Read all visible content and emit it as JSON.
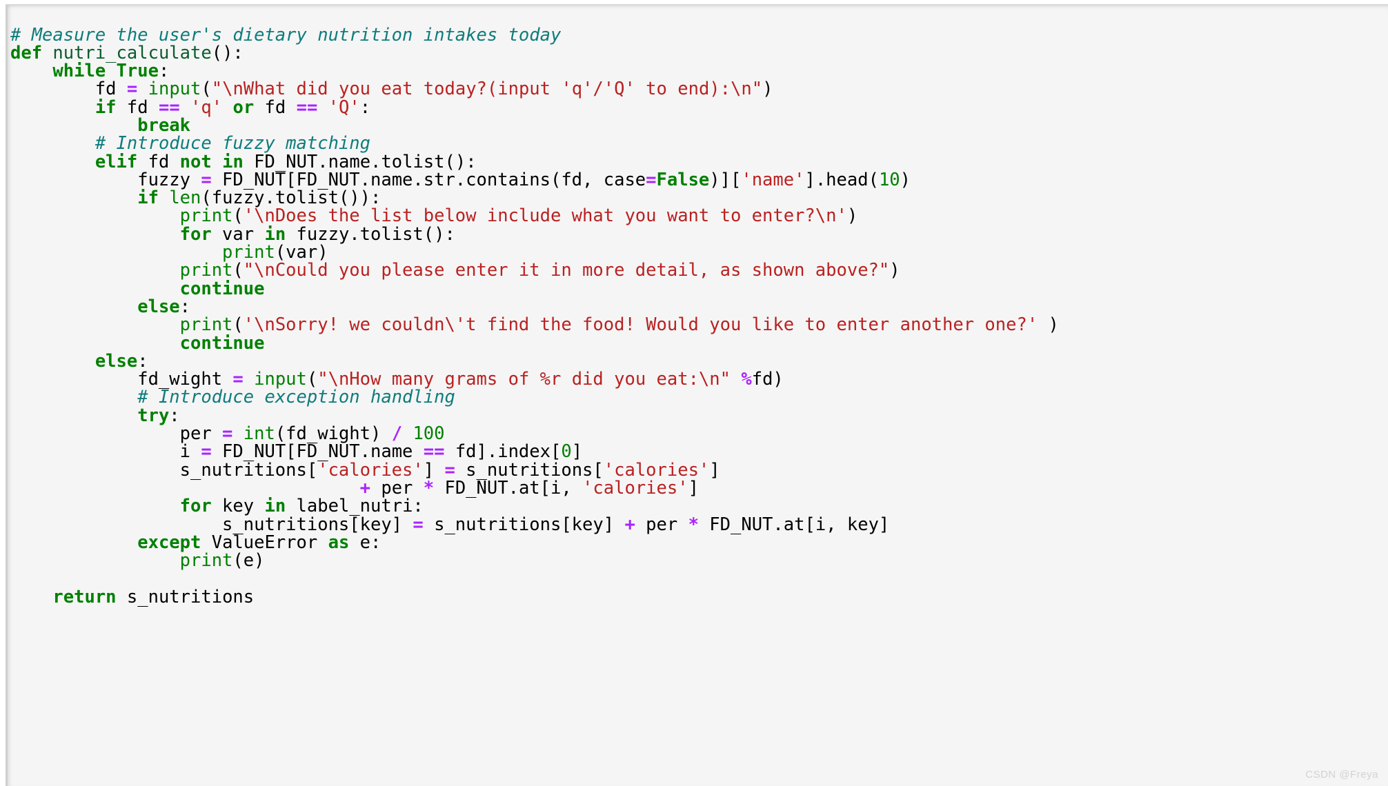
{
  "meta": {
    "language": "python",
    "background_color": "#f5f5f5",
    "page_background": "#ffffff",
    "watermark": "CSDN @Freya"
  },
  "palette": {
    "keyword": "#008000",
    "builtin": "#008000",
    "string": "#ba2121",
    "number": "#008000",
    "operator": "#aa22ff",
    "comment": "#0e7c7b",
    "plain": "#000000",
    "constant": "#008000"
  },
  "code": {
    "lines": [
      {
        "index": 1,
        "text": "# Measure the user's dietary nutrition intakes today",
        "tokens": [
          {
            "t": "com",
            "s": "# Measure the user's dietary nutrition intakes today"
          }
        ]
      },
      {
        "index": 2,
        "text": "def nutri_calculate():",
        "tokens": [
          {
            "t": "kw",
            "s": "def"
          },
          {
            "t": "plain",
            "s": " "
          },
          {
            "t": "defname",
            "s": "nutri_calculate"
          },
          {
            "t": "punct",
            "s": "():"
          }
        ]
      },
      {
        "index": 3,
        "text": "    while True:",
        "tokens": [
          {
            "t": "plain",
            "s": "    "
          },
          {
            "t": "kw",
            "s": "while"
          },
          {
            "t": "plain",
            "s": " "
          },
          {
            "t": "const",
            "s": "True"
          },
          {
            "t": "punct",
            "s": ":"
          }
        ]
      },
      {
        "index": 4,
        "text": "        fd = input(\"\\nWhat did you eat today?(input 'q'/'Q' to end):\\n\")",
        "tokens": [
          {
            "t": "plain",
            "s": "        fd "
          },
          {
            "t": "op",
            "s": "="
          },
          {
            "t": "plain",
            "s": " "
          },
          {
            "t": "builtin",
            "s": "input"
          },
          {
            "t": "punct",
            "s": "("
          },
          {
            "t": "str",
            "s": "\"\\nWhat did you eat today?(input 'q'/'Q' to end):\\n\""
          },
          {
            "t": "punct",
            "s": ")"
          }
        ]
      },
      {
        "index": 5,
        "text": "        if fd == 'q' or fd == 'Q':",
        "tokens": [
          {
            "t": "plain",
            "s": "        "
          },
          {
            "t": "kw",
            "s": "if"
          },
          {
            "t": "plain",
            "s": " fd "
          },
          {
            "t": "op",
            "s": "=="
          },
          {
            "t": "plain",
            "s": " "
          },
          {
            "t": "str",
            "s": "'q'"
          },
          {
            "t": "plain",
            "s": " "
          },
          {
            "t": "kw",
            "s": "or"
          },
          {
            "t": "plain",
            "s": " fd "
          },
          {
            "t": "op",
            "s": "=="
          },
          {
            "t": "plain",
            "s": " "
          },
          {
            "t": "str",
            "s": "'Q'"
          },
          {
            "t": "punct",
            "s": ":"
          }
        ]
      },
      {
        "index": 6,
        "text": "            break",
        "tokens": [
          {
            "t": "plain",
            "s": "            "
          },
          {
            "t": "kw",
            "s": "break"
          }
        ]
      },
      {
        "index": 7,
        "text": "        # Introduce fuzzy matching",
        "tokens": [
          {
            "t": "plain",
            "s": "        "
          },
          {
            "t": "com",
            "s": "# Introduce fuzzy matching"
          }
        ]
      },
      {
        "index": 8,
        "text": "        elif fd not in FD_NUT.name.tolist():",
        "tokens": [
          {
            "t": "plain",
            "s": "        "
          },
          {
            "t": "kw",
            "s": "elif"
          },
          {
            "t": "plain",
            "s": " fd "
          },
          {
            "t": "kw",
            "s": "not"
          },
          {
            "t": "plain",
            "s": " "
          },
          {
            "t": "kw",
            "s": "in"
          },
          {
            "t": "plain",
            "s": " FD_NUT.name.tolist():"
          }
        ]
      },
      {
        "index": 9,
        "text": "            fuzzy = FD_NUT[FD_NUT.name.str.contains(fd, case=False)]['name'].head(10)",
        "tokens": [
          {
            "t": "plain",
            "s": "            fuzzy "
          },
          {
            "t": "op",
            "s": "="
          },
          {
            "t": "plain",
            "s": " FD_NUT[FD_NUT.name.str.contains(fd, case"
          },
          {
            "t": "op",
            "s": "="
          },
          {
            "t": "const",
            "s": "False"
          },
          {
            "t": "plain",
            "s": ")]["
          },
          {
            "t": "str",
            "s": "'name'"
          },
          {
            "t": "plain",
            "s": "].head("
          },
          {
            "t": "num",
            "s": "10"
          },
          {
            "t": "plain",
            "s": ")"
          }
        ]
      },
      {
        "index": 10,
        "text": "            if len(fuzzy.tolist()):",
        "tokens": [
          {
            "t": "plain",
            "s": "            "
          },
          {
            "t": "kw",
            "s": "if"
          },
          {
            "t": "plain",
            "s": " "
          },
          {
            "t": "builtin",
            "s": "len"
          },
          {
            "t": "plain",
            "s": "(fuzzy.tolist()):"
          }
        ]
      },
      {
        "index": 11,
        "text": "                print('\\nDoes the list below include what you want to enter?\\n')",
        "tokens": [
          {
            "t": "plain",
            "s": "                "
          },
          {
            "t": "builtin",
            "s": "print"
          },
          {
            "t": "punct",
            "s": "("
          },
          {
            "t": "str",
            "s": "'\\nDoes the list below include what you want to enter?\\n'"
          },
          {
            "t": "punct",
            "s": ")"
          }
        ]
      },
      {
        "index": 12,
        "text": "                for var in fuzzy.tolist():",
        "tokens": [
          {
            "t": "plain",
            "s": "                "
          },
          {
            "t": "kw",
            "s": "for"
          },
          {
            "t": "plain",
            "s": " var "
          },
          {
            "t": "kw",
            "s": "in"
          },
          {
            "t": "plain",
            "s": " fuzzy.tolist():"
          }
        ]
      },
      {
        "index": 13,
        "text": "                    print(var)",
        "tokens": [
          {
            "t": "plain",
            "s": "                    "
          },
          {
            "t": "builtin",
            "s": "print"
          },
          {
            "t": "plain",
            "s": "(var)"
          }
        ]
      },
      {
        "index": 14,
        "text": "                print(\"\\nCould you please enter it in more detail, as shown above?\")",
        "tokens": [
          {
            "t": "plain",
            "s": "                "
          },
          {
            "t": "builtin",
            "s": "print"
          },
          {
            "t": "punct",
            "s": "("
          },
          {
            "t": "str",
            "s": "\"\\nCould you please enter it in more detail, as shown above?\""
          },
          {
            "t": "punct",
            "s": ")"
          }
        ]
      },
      {
        "index": 15,
        "text": "                continue",
        "tokens": [
          {
            "t": "plain",
            "s": "                "
          },
          {
            "t": "kw",
            "s": "continue"
          }
        ]
      },
      {
        "index": 16,
        "text": "            else:",
        "tokens": [
          {
            "t": "plain",
            "s": "            "
          },
          {
            "t": "kw",
            "s": "else"
          },
          {
            "t": "punct",
            "s": ":"
          }
        ]
      },
      {
        "index": 17,
        "text": "                print('\\nSorry! we couldn\\'t find the food! Would you like to enter another one?' )",
        "tokens": [
          {
            "t": "plain",
            "s": "                "
          },
          {
            "t": "builtin",
            "s": "print"
          },
          {
            "t": "punct",
            "s": "("
          },
          {
            "t": "str",
            "s": "'\\nSorry! we couldn\\'t find the food! Would you like to enter another one?'"
          },
          {
            "t": "punct",
            "s": " )"
          }
        ]
      },
      {
        "index": 18,
        "text": "                continue",
        "tokens": [
          {
            "t": "plain",
            "s": "                "
          },
          {
            "t": "kw",
            "s": "continue"
          }
        ]
      },
      {
        "index": 19,
        "text": "        else:",
        "tokens": [
          {
            "t": "plain",
            "s": "        "
          },
          {
            "t": "kw",
            "s": "else"
          },
          {
            "t": "punct",
            "s": ":"
          }
        ]
      },
      {
        "index": 20,
        "text": "            fd_wight = input(\"\\nHow many grams of %r did you eat:\\n\" %fd)",
        "tokens": [
          {
            "t": "plain",
            "s": "            fd_wight "
          },
          {
            "t": "op",
            "s": "="
          },
          {
            "t": "plain",
            "s": " "
          },
          {
            "t": "builtin",
            "s": "input"
          },
          {
            "t": "punct",
            "s": "("
          },
          {
            "t": "str",
            "s": "\"\\nHow many grams of %r did you eat:\\n\""
          },
          {
            "t": "plain",
            "s": " "
          },
          {
            "t": "op",
            "s": "%"
          },
          {
            "t": "plain",
            "s": "fd)"
          }
        ]
      },
      {
        "index": 21,
        "text": "            # Introduce exception handling",
        "tokens": [
          {
            "t": "plain",
            "s": "            "
          },
          {
            "t": "com",
            "s": "# Introduce exception handling"
          }
        ]
      },
      {
        "index": 22,
        "text": "            try:",
        "tokens": [
          {
            "t": "plain",
            "s": "            "
          },
          {
            "t": "kw",
            "s": "try"
          },
          {
            "t": "punct",
            "s": ":"
          }
        ]
      },
      {
        "index": 23,
        "text": "                per = int(fd_wight) / 100",
        "tokens": [
          {
            "t": "plain",
            "s": "                per "
          },
          {
            "t": "op",
            "s": "="
          },
          {
            "t": "plain",
            "s": " "
          },
          {
            "t": "builtin",
            "s": "int"
          },
          {
            "t": "plain",
            "s": "(fd_wight) "
          },
          {
            "t": "op",
            "s": "/"
          },
          {
            "t": "plain",
            "s": " "
          },
          {
            "t": "num",
            "s": "100"
          }
        ]
      },
      {
        "index": 24,
        "text": "                i = FD_NUT[FD_NUT.name == fd].index[0]",
        "tokens": [
          {
            "t": "plain",
            "s": "                i "
          },
          {
            "t": "op",
            "s": "="
          },
          {
            "t": "plain",
            "s": " FD_NUT[FD_NUT.name "
          },
          {
            "t": "op",
            "s": "=="
          },
          {
            "t": "plain",
            "s": " fd].index["
          },
          {
            "t": "num",
            "s": "0"
          },
          {
            "t": "plain",
            "s": "]"
          }
        ]
      },
      {
        "index": 25,
        "text": "                s_nutritions['calories'] = s_nutritions['calories']",
        "tokens": [
          {
            "t": "plain",
            "s": "                s_nutritions["
          },
          {
            "t": "str",
            "s": "'calories'"
          },
          {
            "t": "plain",
            "s": "] "
          },
          {
            "t": "op",
            "s": "="
          },
          {
            "t": "plain",
            "s": " s_nutritions["
          },
          {
            "t": "str",
            "s": "'calories'"
          },
          {
            "t": "plain",
            "s": "]"
          }
        ]
      },
      {
        "index": 26,
        "text": "                                 + per * FD_NUT.at[i, 'calories']",
        "tokens": [
          {
            "t": "plain",
            "s": "                                 "
          },
          {
            "t": "op",
            "s": "+"
          },
          {
            "t": "plain",
            "s": " per "
          },
          {
            "t": "op",
            "s": "*"
          },
          {
            "t": "plain",
            "s": " FD_NUT.at[i, "
          },
          {
            "t": "str",
            "s": "'calories'"
          },
          {
            "t": "plain",
            "s": "]"
          }
        ]
      },
      {
        "index": 27,
        "text": "                for key in label_nutri:",
        "tokens": [
          {
            "t": "plain",
            "s": "                "
          },
          {
            "t": "kw",
            "s": "for"
          },
          {
            "t": "plain",
            "s": " key "
          },
          {
            "t": "kw",
            "s": "in"
          },
          {
            "t": "plain",
            "s": " label_nutri:"
          }
        ]
      },
      {
        "index": 28,
        "text": "                    s_nutritions[key] = s_nutritions[key] + per * FD_NUT.at[i, key]",
        "tokens": [
          {
            "t": "plain",
            "s": "                    s_nutritions[key] "
          },
          {
            "t": "op",
            "s": "="
          },
          {
            "t": "plain",
            "s": " s_nutritions[key] "
          },
          {
            "t": "op",
            "s": "+"
          },
          {
            "t": "plain",
            "s": " per "
          },
          {
            "t": "op",
            "s": "*"
          },
          {
            "t": "plain",
            "s": " FD_NUT.at[i, key]"
          }
        ]
      },
      {
        "index": 29,
        "text": "            except ValueError as e:",
        "tokens": [
          {
            "t": "plain",
            "s": "            "
          },
          {
            "t": "kw",
            "s": "except"
          },
          {
            "t": "plain",
            "s": " ValueError "
          },
          {
            "t": "kw",
            "s": "as"
          },
          {
            "t": "plain",
            "s": " e:"
          }
        ]
      },
      {
        "index": 30,
        "text": "                print(e)",
        "tokens": [
          {
            "t": "plain",
            "s": "                "
          },
          {
            "t": "builtin",
            "s": "print"
          },
          {
            "t": "plain",
            "s": "(e)"
          }
        ]
      },
      {
        "index": 31,
        "text": "",
        "tokens": []
      },
      {
        "index": 32,
        "text": "    return s_nutritions",
        "tokens": [
          {
            "t": "plain",
            "s": "    "
          },
          {
            "t": "kw",
            "s": "return"
          },
          {
            "t": "plain",
            "s": " s_nutritions"
          }
        ]
      }
    ]
  }
}
